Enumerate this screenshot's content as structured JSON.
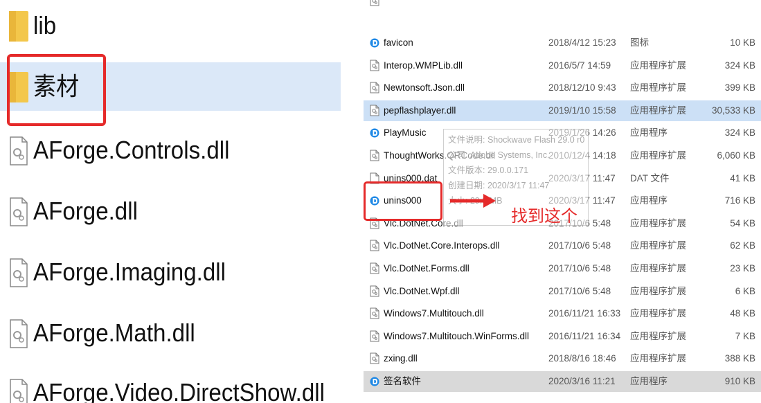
{
  "left_panel": {
    "items": [
      {
        "label": "lib",
        "icon": "folder-icon"
      },
      {
        "label": "素材",
        "icon": "folder-icon"
      },
      {
        "label": "AForge.Controls.dll",
        "icon": "dll-file-icon"
      },
      {
        "label": "AForge.dll",
        "icon": "dll-file-icon"
      },
      {
        "label": "AForge.Imaging.dll",
        "icon": "dll-file-icon"
      },
      {
        "label": "AForge.Math.dll",
        "icon": "dll-file-icon"
      },
      {
        "label": "AForge.Video.DirectShow.dll",
        "icon": "dll-file-icon"
      }
    ],
    "selected_index": 1
  },
  "file_list": {
    "rows": [
      {
        "name": "favicon",
        "date": "2018/4/12 15:23",
        "type": "图标",
        "size": "10 KB",
        "icon": "app-icon"
      },
      {
        "name": "Interop.WMPLib.dll",
        "date": "2016/5/7 14:59",
        "type": "应用程序扩展",
        "size": "324 KB",
        "icon": "dll-file-icon"
      },
      {
        "name": "Newtonsoft.Json.dll",
        "date": "2018/12/10 9:43",
        "type": "应用程序扩展",
        "size": "399 KB",
        "icon": "dll-file-icon"
      },
      {
        "name": "pepflashplayer.dll",
        "date": "2019/1/10 15:58",
        "type": "应用程序扩展",
        "size": "30,533 KB",
        "icon": "dll-file-icon"
      },
      {
        "name": "PlayMusic",
        "date": "2019/1/26 14:26",
        "type": "应用程序",
        "size": "324 KB",
        "icon": "app-icon"
      },
      {
        "name": "ThoughtWorks.QRCode.dll",
        "date": "2010/12/4 14:18",
        "type": "应用程序扩展",
        "size": "6,060 KB",
        "icon": "dll-file-icon"
      },
      {
        "name": "unins000.dat",
        "date": "2020/3/17 11:47",
        "type": "DAT 文件",
        "size": "41 KB",
        "icon": "file-icon"
      },
      {
        "name": "unins000",
        "date": "2020/3/17 11:47",
        "type": "应用程序",
        "size": "716 KB",
        "icon": "app-icon"
      },
      {
        "name": "Vlc.DotNet.Core.dll",
        "date": "2017/10/6 5:48",
        "type": "应用程序扩展",
        "size": "54 KB",
        "icon": "dll-file-icon"
      },
      {
        "name": "Vlc.DotNet.Core.Interops.dll",
        "date": "2017/10/6 5:48",
        "type": "应用程序扩展",
        "size": "62 KB",
        "icon": "dll-file-icon"
      },
      {
        "name": "Vlc.DotNet.Forms.dll",
        "date": "2017/10/6 5:48",
        "type": "应用程序扩展",
        "size": "23 KB",
        "icon": "dll-file-icon"
      },
      {
        "name": "Vlc.DotNet.Wpf.dll",
        "date": "2017/10/6 5:48",
        "type": "应用程序扩展",
        "size": "6 KB",
        "icon": "dll-file-icon"
      },
      {
        "name": "Windows7.Multitouch.dll",
        "date": "2016/11/21 16:33",
        "type": "应用程序扩展",
        "size": "48 KB",
        "icon": "dll-file-icon"
      },
      {
        "name": "Windows7.Multitouch.WinForms.dll",
        "date": "2016/11/21 16:34",
        "type": "应用程序扩展",
        "size": "7 KB",
        "icon": "dll-file-icon"
      },
      {
        "name": "zxing.dll",
        "date": "2018/8/16 18:46",
        "type": "应用程序扩展",
        "size": "388 KB",
        "icon": "dll-file-icon"
      },
      {
        "name": "签名软件",
        "date": "2020/3/16 11:21",
        "type": "应用程序",
        "size": "910 KB",
        "icon": "app-icon"
      }
    ],
    "hover_row_index": 3,
    "selected_row_index": 15
  },
  "tooltip": {
    "lines": [
      "文件说明: Shockwave Flash 29.0 r0",
      "公司: Adobe Systems, Inc.",
      "文件版本: 29.0.0.171",
      "创建日期: 2020/3/17 11:47",
      "大小: 29.8 MB"
    ]
  },
  "annotation": {
    "text": "找到这个",
    "color": "#e52a2a"
  },
  "colors": {
    "highlight_red": "#e52a2a",
    "folder_yellow": "#f3c74b",
    "selection_blue": "#cce0f6",
    "app_icon_blue": "#1e88e5"
  }
}
